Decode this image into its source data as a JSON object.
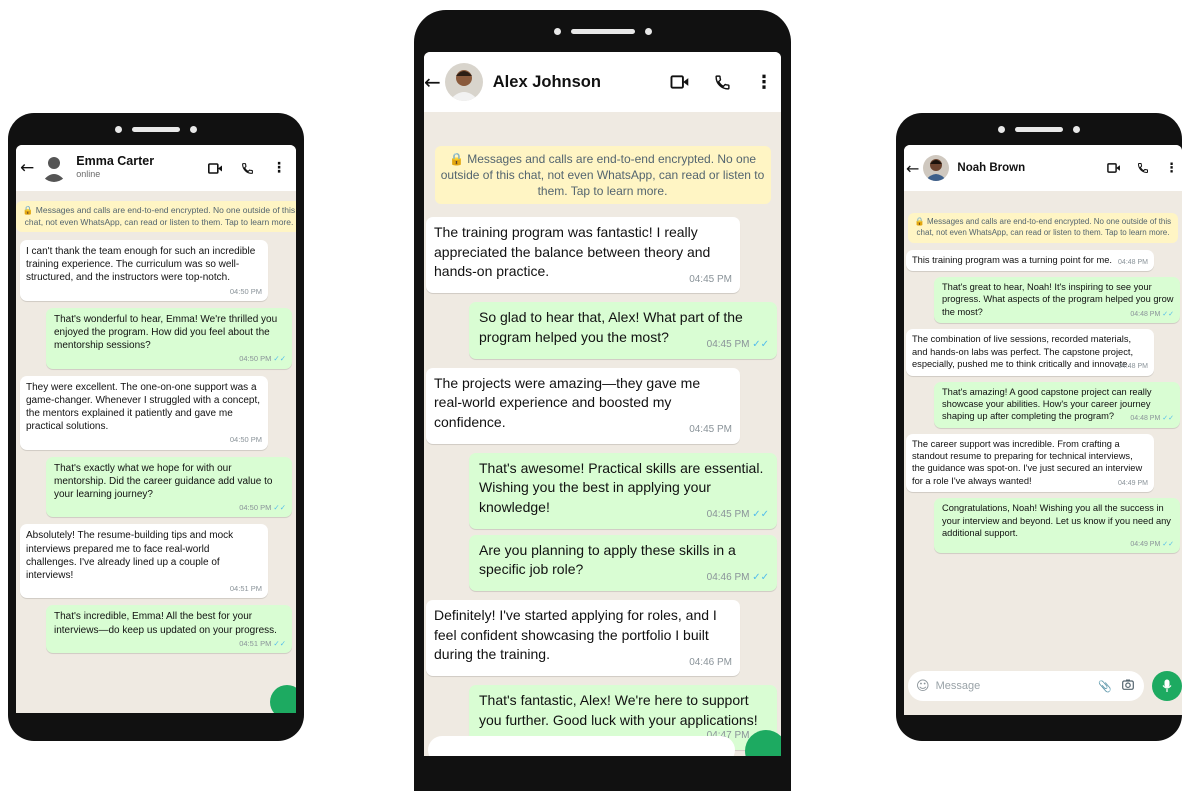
{
  "phones": [
    {
      "contact_name": "Emma Carter",
      "contact_status": "online",
      "encryption_notice": "🔒 Messages and calls are end-to-end encrypted. No one outside of this chat, not even WhatsApp, can read or listen to them. Tap to learn more.",
      "messages": [
        {
          "dir": "in",
          "text": "I can't thank the team enough for such an incredible training experience. The curriculum was so well-structured, and the instructors were top-notch.",
          "time": "04:50 PM"
        },
        {
          "dir": "out",
          "text": "That's wonderful to hear, Emma! We're thrilled you enjoyed the program. How did you feel about the mentorship sessions?",
          "time": "04:50 PM"
        },
        {
          "dir": "in",
          "text": "They were excellent. The one-on-one support was a game-changer. Whenever I struggled with a concept, the mentors explained it patiently and gave me practical solutions.",
          "time": "04:50 PM"
        },
        {
          "dir": "out",
          "text": "That's exactly what we hope for with our mentorship. Did the career guidance add value to your learning journey?",
          "time": "04:50 PM"
        },
        {
          "dir": "in",
          "text": "Absolutely! The resume-building tips and mock interviews prepared me to face real-world challenges. I've already lined up a couple of interviews!",
          "time": "04:51 PM"
        },
        {
          "dir": "out",
          "text": "That's incredible, Emma! All the best for your interviews—do keep us updated on your progress.",
          "time": "04:51 PM"
        }
      ]
    },
    {
      "contact_name": "Alex Johnson",
      "encryption_notice": "🔒 Messages and calls are end-to-end encrypted. No one outside of this chat, not even WhatsApp, can read or listen to them. Tap to learn more.",
      "messages": [
        {
          "dir": "in",
          "text": "The training program was fantastic! I really appreciated the balance between theory and hands-on practice.",
          "time": "04:45 PM"
        },
        {
          "dir": "out",
          "text": "So glad to hear that, Alex! What part of the program helped you the most?",
          "time": "04:45 PM"
        },
        {
          "dir": "in",
          "text": "The projects were amazing—they gave me real-world experience and boosted my confidence.",
          "time": "04:45 PM"
        },
        {
          "dir": "out",
          "text": "That's awesome! Practical skills are essential. Wishing you the best in applying your knowledge!",
          "time": "04:45 PM"
        },
        {
          "dir": "out",
          "text": "Are you planning to apply these skills in a specific job role?",
          "time": "04:46 PM"
        },
        {
          "dir": "in",
          "text": "Definitely! I've started applying for roles, and I feel confident showcasing the portfolio I built during the training.",
          "time": "04:46 PM"
        },
        {
          "dir": "out",
          "text": "That's fantastic, Alex! We're here to support you further. Good luck with your applications!",
          "time": "04:47 PM"
        }
      ]
    },
    {
      "contact_name": "Noah Brown",
      "encryption_notice": "🔒 Messages and calls are end-to-end encrypted. No one outside of this chat, not even WhatsApp, can read or listen to them. Tap to learn more.",
      "messages": [
        {
          "dir": "in",
          "text": "This training program was a turning point for me.",
          "time": "04:48 PM"
        },
        {
          "dir": "out",
          "text": "That's great to hear, Noah! It's inspiring to see your progress. What aspects of the program helped you grow the most?",
          "time": "04:48 PM"
        },
        {
          "dir": "in",
          "text": "The combination of live sessions, recorded materials, and hands-on labs was perfect. The capstone project, especially, pushed me to think critically and innovate.",
          "time": "04:48 PM"
        },
        {
          "dir": "out",
          "text": "That's amazing! A good capstone project can really showcase your abilities. How's your career journey shaping up after completing the program?",
          "time": "04:48 PM"
        },
        {
          "dir": "in",
          "text": "The career support was incredible. From crafting a standout resume to preparing for technical interviews, the guidance was spot-on. I've just secured an interview for a role I've always wanted!",
          "time": "04:49 PM"
        },
        {
          "dir": "out",
          "text": "Congratulations, Noah! Wishing you all the success in your interview and beyond. Let us know if you need any additional support.",
          "time": "04:49 PM"
        }
      ],
      "input_placeholder": "Message"
    }
  ],
  "icons": {
    "back": "back-arrow-icon",
    "video": "video-camera-icon",
    "call": "phone-icon",
    "menu": "more-vertical-icon",
    "read": "double-check-icon",
    "emoji": "emoji-icon",
    "attach": "paperclip-icon",
    "camera": "camera-icon",
    "mic": "microphone-icon"
  },
  "colors": {
    "chat_bg": "#efeae2",
    "incoming": "#ffffff",
    "outgoing": "#d9fdd3",
    "notice": "#fff5c4",
    "accent": "#1daa61",
    "read_tick": "#53bdeb"
  }
}
